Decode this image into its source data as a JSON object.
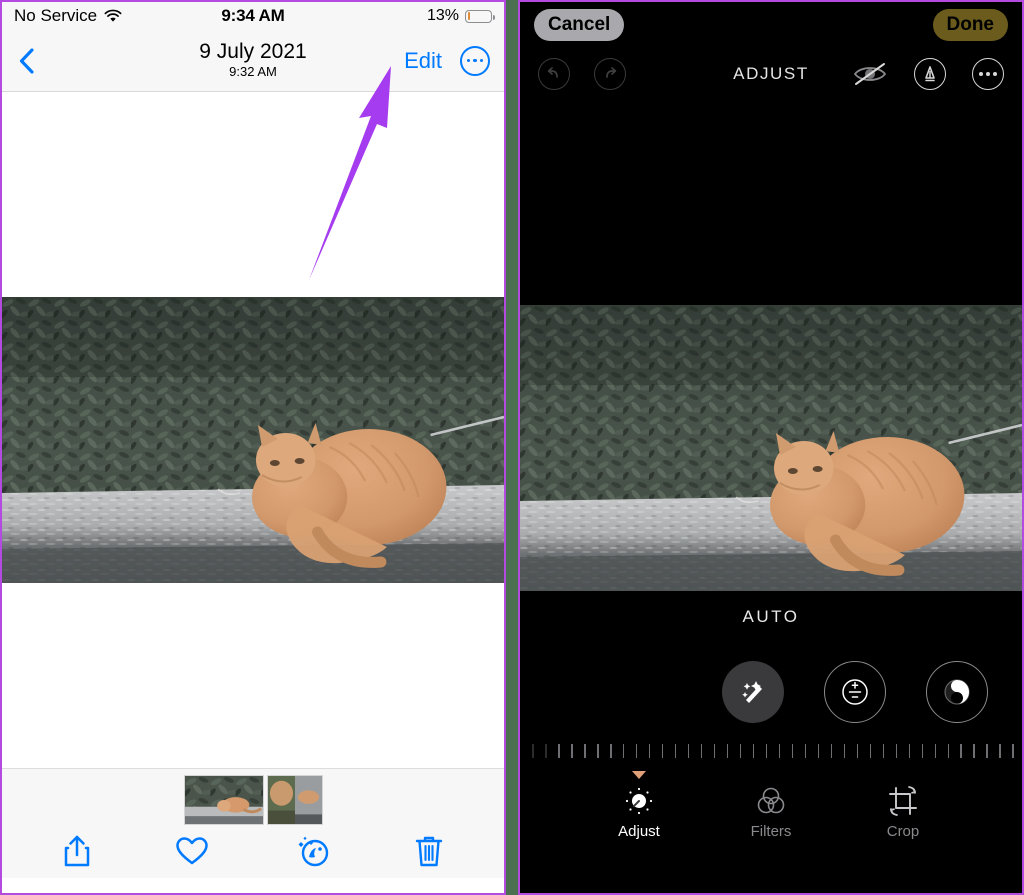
{
  "left_panel": {
    "status_bar": {
      "carrier": "No Service",
      "wifi_icon": "wifi-icon",
      "time": "9:34 AM",
      "battery_percent": "13%",
      "battery_level": 13,
      "battery_color": "#e08a3c"
    },
    "nav_bar": {
      "back_icon": "chevron-left-icon",
      "title": "9 July 2021",
      "subtitle": "9:32 AM",
      "edit_label": "Edit",
      "more_icon": "more-ellipsis-circle-icon",
      "accent_color": "#007aff"
    },
    "photo": {
      "alt": "Orange tabby cat sitting on a concrete ledge in front of dark green foliage"
    },
    "filmstrip": {
      "thumbs": [
        "thumbnail-cat-on-ledge",
        "thumbnail-cat-pair"
      ]
    },
    "toolbar": {
      "items": [
        {
          "name": "share-icon",
          "label": "Share"
        },
        {
          "name": "favorite-heart-icon",
          "label": "Favorite"
        },
        {
          "name": "live-photo-effects-icon",
          "label": "Live"
        },
        {
          "name": "trash-icon",
          "label": "Delete"
        }
      ],
      "tint_color": "#007aff"
    }
  },
  "right_panel": {
    "top_bar": {
      "cancel_label": "Cancel",
      "done_label": "Done",
      "cancel_bg": "#a8a8ad",
      "done_bg": "#6b5c1e"
    },
    "tool_bar": {
      "undo_icon": "undo-arrow-icon",
      "redo_icon": "redo-arrow-icon",
      "mode_label": "ADJUST",
      "hide_icon": "eye-slash-icon",
      "markup_icon": "markup-pen-circle-icon",
      "more_icon": "more-ellipsis-circle-icon"
    },
    "adjust_panel": {
      "auto_label": "AUTO",
      "effects": [
        {
          "name": "auto-enhance-magic-wand-icon",
          "active": true
        },
        {
          "name": "exposure-plus-minus-icon",
          "active": false
        },
        {
          "name": "contrast-circle-icon",
          "active": false
        }
      ],
      "slider_ticks": 40,
      "slider_value": 0
    },
    "tabs": [
      {
        "name": "tab-adjust",
        "label": "Adjust",
        "icon": "adjust-dial-icon",
        "active": true
      },
      {
        "name": "tab-filters",
        "label": "Filters",
        "icon": "filters-circles-icon",
        "active": false
      },
      {
        "name": "tab-crop",
        "label": "Crop",
        "icon": "crop-rotate-icon",
        "active": false
      }
    ],
    "caret_color": "#e0a079"
  },
  "annotations": {
    "arrow_color": "#a63cf0",
    "arrows": [
      {
        "name": "arrow-pointing-to-edit",
        "target": "Edit"
      },
      {
        "name": "arrow-pointing-to-markup",
        "target": "markup-pen-circle-icon"
      }
    ]
  },
  "divider": {
    "color": "#4a7050"
  },
  "panel_border_color": "#b44be0"
}
